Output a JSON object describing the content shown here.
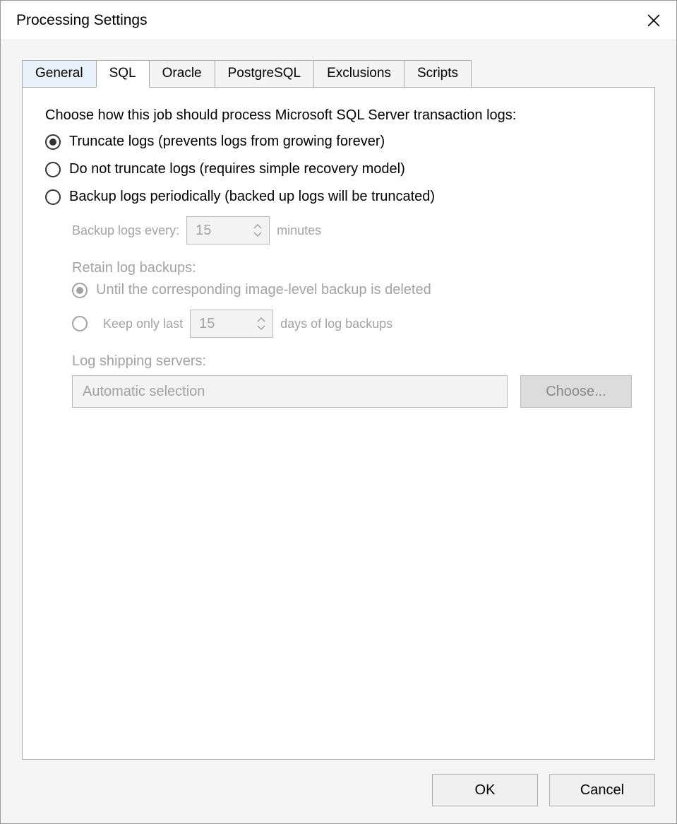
{
  "window": {
    "title": "Processing Settings"
  },
  "tabs": {
    "general": "General",
    "sql": "SQL",
    "oracle": "Oracle",
    "postgresql": "PostgreSQL",
    "exclusions": "Exclusions",
    "scripts": "Scripts"
  },
  "sql": {
    "description": "Choose how this job should process Microsoft SQL Server transaction logs:",
    "options": {
      "truncate": "Truncate logs (prevents logs from growing forever)",
      "do_not_truncate": "Do not truncate logs (requires simple recovery model)",
      "backup_periodically": "Backup logs periodically (backed up logs will be truncated)"
    },
    "backup_every_label": "Backup logs every:",
    "backup_every_value": "15",
    "backup_every_unit": "minutes",
    "retain_label": "Retain log backups:",
    "retain_options": {
      "until_deleted": "Until the corresponding image-level backup is deleted",
      "keep_last_prefix": "Keep only last",
      "keep_last_value": "15",
      "keep_last_suffix": "days of log backups"
    },
    "shipping_label": "Log shipping servers:",
    "shipping_value": "Automatic selection",
    "choose_button": "Choose..."
  },
  "buttons": {
    "ok": "OK",
    "cancel": "Cancel"
  }
}
